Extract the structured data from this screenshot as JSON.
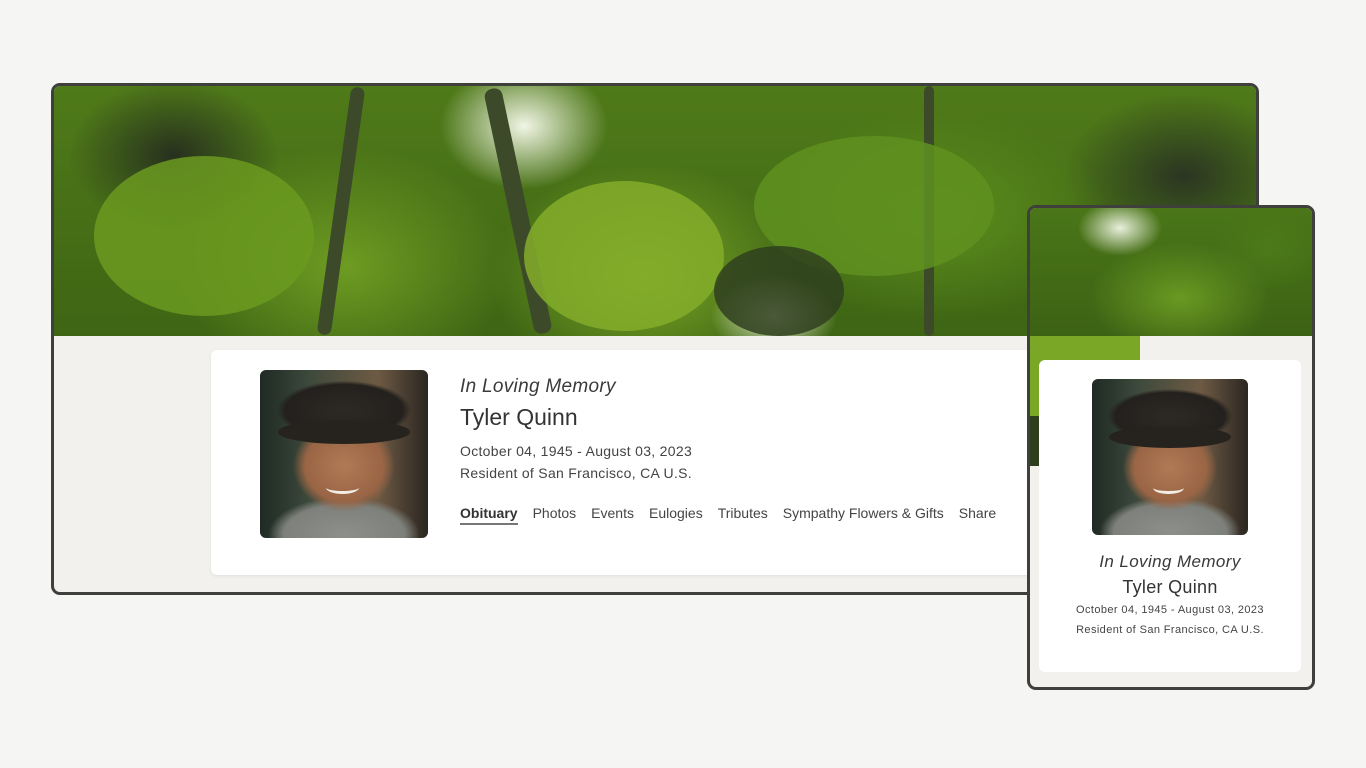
{
  "desktop": {
    "memorial": {
      "heading": "In Loving Memory",
      "name": "Tyler Quinn",
      "dates": "October 04, 1945 - August 03, 2023",
      "residence": "Resident of San Francisco, CA U.S."
    },
    "tabs": [
      {
        "label": "Obituary",
        "active": true
      },
      {
        "label": "Photos",
        "active": false
      },
      {
        "label": "Events",
        "active": false
      },
      {
        "label": "Eulogies",
        "active": false
      },
      {
        "label": "Tributes",
        "active": false
      },
      {
        "label": "Sympathy Flowers & Gifts",
        "active": false
      },
      {
        "label": "Share",
        "active": false
      }
    ]
  },
  "mobile": {
    "memorial": {
      "heading": "In Loving Memory",
      "name": "Tyler Quinn",
      "dates": "October 04, 1945 - August 03, 2023",
      "residence": "Resident of San Francisco, CA U.S."
    }
  },
  "colors": {
    "background": "#f5f5f4",
    "frame_border": "#3f403c",
    "card": "#ffffff",
    "foliage": "#5c8e1c"
  }
}
